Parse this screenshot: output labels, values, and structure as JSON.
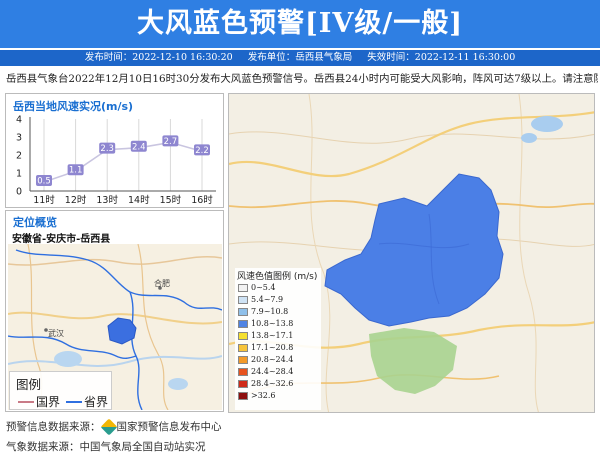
{
  "header": {
    "title": "大风蓝色预警[IV级/一般]",
    "publish_time": "发布时间：2022-12-10 16:30:20",
    "publisher": "发布单位：岳西县气象局",
    "expire_time": "失效时间：2022-12-11 16:30:00"
  },
  "description": "岳西县气象台2022年12月10日16时30分发布大风蓝色预警信号。岳西县24小时内可能受大风影响，阵风可达7级以上。请注意防范！",
  "wind_panel": {
    "title": "岳西当地风速实况(m/s)"
  },
  "chart_data": {
    "type": "line",
    "title": "岳西当地风速实况(m/s)",
    "categories": [
      "11时",
      "12时",
      "13时",
      "14时",
      "15时",
      "16时"
    ],
    "series": [
      {
        "values": [
          0.5,
          1.1,
          2.3,
          2.4,
          2.7,
          2.2
        ]
      }
    ],
    "ylim": [
      0,
      4
    ],
    "yticks": [
      "0",
      "1",
      "2",
      "3",
      "4"
    ],
    "point_labels": [
      "0.5",
      "1.1",
      "2.3",
      "2.4",
      "2.7",
      "2.2"
    ],
    "colors": {
      "line": "#c9c5e0",
      "label_bg": "#8e86d0",
      "label_text": "#ffffff"
    },
    "grid": "vertical"
  },
  "location_panel": {
    "title": "定位概览",
    "location": "安徽省-安庆市-岳西县",
    "map_labels": [
      "合肥",
      "武汉"
    ],
    "legend": {
      "title": "图例",
      "items": [
        {
          "label": "国界",
          "color": "#c97a86"
        },
        {
          "label": "省界",
          "color": "#2f6fe0"
        }
      ]
    }
  },
  "wind_legend": {
    "title": "风速色值图例 (m/s)",
    "items": [
      {
        "label": "0~5.4",
        "color": "#f2f2f2"
      },
      {
        "label": "5.4~7.9",
        "color": "#cfe3f5"
      },
      {
        "label": "7.9~10.8",
        "color": "#8fc0ea"
      },
      {
        "label": "10.8~13.8",
        "color": "#4f83e3"
      },
      {
        "label": "13.8~17.1",
        "color": "#f5e030"
      },
      {
        "label": "17.1~20.8",
        "color": "#f7c43a"
      },
      {
        "label": "20.8~24.4",
        "color": "#f39a2a"
      },
      {
        "label": "24.4~28.4",
        "color": "#e8531f"
      },
      {
        "label": "28.4~32.6",
        "color": "#cf2a19"
      },
      {
        "label": ">32.6",
        "color": "#8c0f0f"
      }
    ]
  },
  "footer": {
    "source1_prefix": "预警信息数据来源：",
    "source1_name": "国家预警信息发布中心",
    "source2": "气象数据来源：中国气象局全国自动站实况"
  }
}
